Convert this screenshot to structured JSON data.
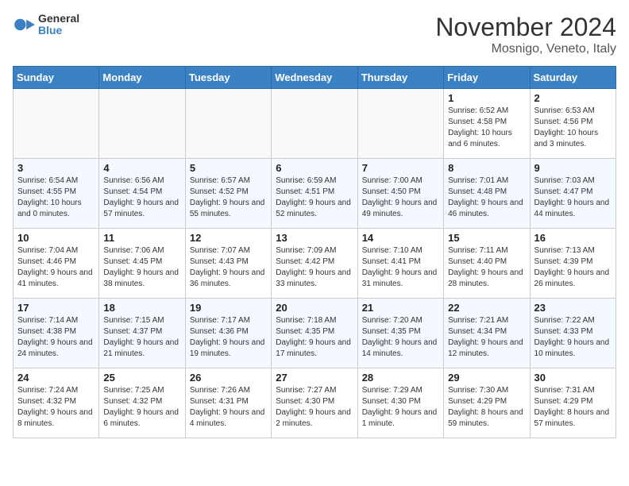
{
  "header": {
    "logo_line1": "General",
    "logo_line2": "Blue",
    "month_title": "November 2024",
    "location": "Mosnigo, Veneto, Italy"
  },
  "weekdays": [
    "Sunday",
    "Monday",
    "Tuesday",
    "Wednesday",
    "Thursday",
    "Friday",
    "Saturday"
  ],
  "weeks": [
    [
      {
        "day": "",
        "info": ""
      },
      {
        "day": "",
        "info": ""
      },
      {
        "day": "",
        "info": ""
      },
      {
        "day": "",
        "info": ""
      },
      {
        "day": "",
        "info": ""
      },
      {
        "day": "1",
        "info": "Sunrise: 6:52 AM\nSunset: 4:58 PM\nDaylight: 10 hours and 6 minutes."
      },
      {
        "day": "2",
        "info": "Sunrise: 6:53 AM\nSunset: 4:56 PM\nDaylight: 10 hours and 3 minutes."
      }
    ],
    [
      {
        "day": "3",
        "info": "Sunrise: 6:54 AM\nSunset: 4:55 PM\nDaylight: 10 hours and 0 minutes."
      },
      {
        "day": "4",
        "info": "Sunrise: 6:56 AM\nSunset: 4:54 PM\nDaylight: 9 hours and 57 minutes."
      },
      {
        "day": "5",
        "info": "Sunrise: 6:57 AM\nSunset: 4:52 PM\nDaylight: 9 hours and 55 minutes."
      },
      {
        "day": "6",
        "info": "Sunrise: 6:59 AM\nSunset: 4:51 PM\nDaylight: 9 hours and 52 minutes."
      },
      {
        "day": "7",
        "info": "Sunrise: 7:00 AM\nSunset: 4:50 PM\nDaylight: 9 hours and 49 minutes."
      },
      {
        "day": "8",
        "info": "Sunrise: 7:01 AM\nSunset: 4:48 PM\nDaylight: 9 hours and 46 minutes."
      },
      {
        "day": "9",
        "info": "Sunrise: 7:03 AM\nSunset: 4:47 PM\nDaylight: 9 hours and 44 minutes."
      }
    ],
    [
      {
        "day": "10",
        "info": "Sunrise: 7:04 AM\nSunset: 4:46 PM\nDaylight: 9 hours and 41 minutes."
      },
      {
        "day": "11",
        "info": "Sunrise: 7:06 AM\nSunset: 4:45 PM\nDaylight: 9 hours and 38 minutes."
      },
      {
        "day": "12",
        "info": "Sunrise: 7:07 AM\nSunset: 4:43 PM\nDaylight: 9 hours and 36 minutes."
      },
      {
        "day": "13",
        "info": "Sunrise: 7:09 AM\nSunset: 4:42 PM\nDaylight: 9 hours and 33 minutes."
      },
      {
        "day": "14",
        "info": "Sunrise: 7:10 AM\nSunset: 4:41 PM\nDaylight: 9 hours and 31 minutes."
      },
      {
        "day": "15",
        "info": "Sunrise: 7:11 AM\nSunset: 4:40 PM\nDaylight: 9 hours and 28 minutes."
      },
      {
        "day": "16",
        "info": "Sunrise: 7:13 AM\nSunset: 4:39 PM\nDaylight: 9 hours and 26 minutes."
      }
    ],
    [
      {
        "day": "17",
        "info": "Sunrise: 7:14 AM\nSunset: 4:38 PM\nDaylight: 9 hours and 24 minutes."
      },
      {
        "day": "18",
        "info": "Sunrise: 7:15 AM\nSunset: 4:37 PM\nDaylight: 9 hours and 21 minutes."
      },
      {
        "day": "19",
        "info": "Sunrise: 7:17 AM\nSunset: 4:36 PM\nDaylight: 9 hours and 19 minutes."
      },
      {
        "day": "20",
        "info": "Sunrise: 7:18 AM\nSunset: 4:35 PM\nDaylight: 9 hours and 17 minutes."
      },
      {
        "day": "21",
        "info": "Sunrise: 7:20 AM\nSunset: 4:35 PM\nDaylight: 9 hours and 14 minutes."
      },
      {
        "day": "22",
        "info": "Sunrise: 7:21 AM\nSunset: 4:34 PM\nDaylight: 9 hours and 12 minutes."
      },
      {
        "day": "23",
        "info": "Sunrise: 7:22 AM\nSunset: 4:33 PM\nDaylight: 9 hours and 10 minutes."
      }
    ],
    [
      {
        "day": "24",
        "info": "Sunrise: 7:24 AM\nSunset: 4:32 PM\nDaylight: 9 hours and 8 minutes."
      },
      {
        "day": "25",
        "info": "Sunrise: 7:25 AM\nSunset: 4:32 PM\nDaylight: 9 hours and 6 minutes."
      },
      {
        "day": "26",
        "info": "Sunrise: 7:26 AM\nSunset: 4:31 PM\nDaylight: 9 hours and 4 minutes."
      },
      {
        "day": "27",
        "info": "Sunrise: 7:27 AM\nSunset: 4:30 PM\nDaylight: 9 hours and 2 minutes."
      },
      {
        "day": "28",
        "info": "Sunrise: 7:29 AM\nSunset: 4:30 PM\nDaylight: 9 hours and 1 minute."
      },
      {
        "day": "29",
        "info": "Sunrise: 7:30 AM\nSunset: 4:29 PM\nDaylight: 8 hours and 59 minutes."
      },
      {
        "day": "30",
        "info": "Sunrise: 7:31 AM\nSunset: 4:29 PM\nDaylight: 8 hours and 57 minutes."
      }
    ]
  ]
}
